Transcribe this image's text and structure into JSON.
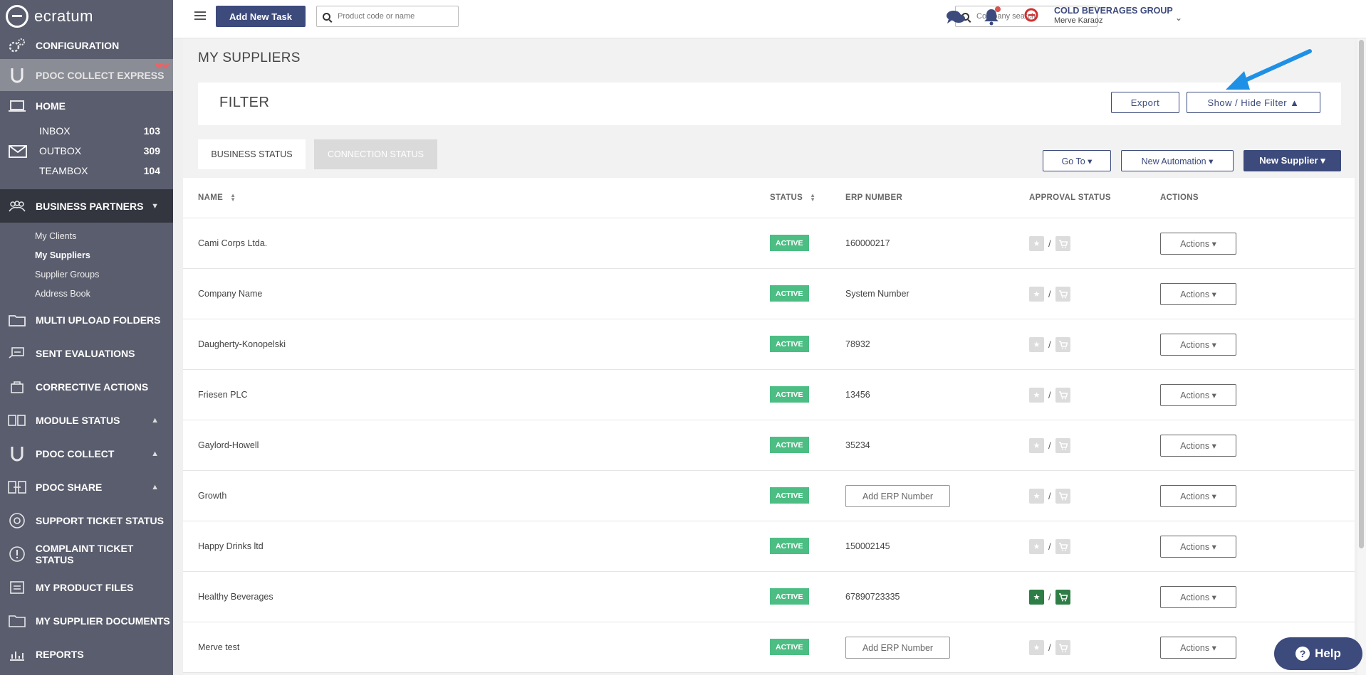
{
  "app": {
    "logo_text": "ecratum"
  },
  "sidebar": {
    "configuration": "CONFIGURATION",
    "pdoc_collect_express": "PDOC COLLECT EXPRESS",
    "new_badge": "NEW!",
    "home": "HOME",
    "inbox": {
      "label": "INBOX",
      "count": "103"
    },
    "outbox": {
      "label": "OUTBOX",
      "count": "309"
    },
    "teambox": {
      "label": "TEAMBOX",
      "count": "104"
    },
    "business_partners": "BUSINESS PARTNERS",
    "sub": [
      "My Clients",
      "My Suppliers",
      "Supplier Groups",
      "Address Book"
    ],
    "multi_upload": "MULTI UPLOAD FOLDERS",
    "sent_evaluations": "SENT EVALUATIONS",
    "corrective_actions": "CORRECTIVE ACTIONS",
    "module_status": "MODULE STATUS",
    "pdoc_collect": "PDOC COLLECT",
    "pdoc_share": "PDOC SHARE",
    "support_ticket": "SUPPORT TICKET STATUS",
    "complaint_ticket": "COMPLAINT TICKET STATUS",
    "product_files": "MY PRODUCT FILES",
    "supplier_documents": "MY SUPPLIER DOCUMENTS",
    "reports": "REPORTS"
  },
  "topbar": {
    "add_task": "Add New Task",
    "product_search_placeholder": "Product code or name",
    "company_search_placeholder": "Company search",
    "company": "COLD BEVERAGES GROUP",
    "user": "Merve Karaoz"
  },
  "page": {
    "title": "MY SUPPLIERS",
    "filter": "FILTER",
    "export": "Export",
    "show_hide": "Show / Hide Filter ▲",
    "tabs": [
      "BUSINESS STATUS",
      "CONNECTION STATUS"
    ],
    "goto": "Go To ▾",
    "new_automation": "New Automation ▾",
    "new_supplier": "New Supplier ▾"
  },
  "table": {
    "headers": {
      "name": "NAME",
      "status": "STATUS",
      "erp": "ERP NUMBER",
      "approval": "APPROVAL STATUS",
      "actions": "ACTIONS"
    },
    "rows": [
      {
        "name": "Cami Corps Ltda.",
        "status": "ACTIVE",
        "erp": "160000217",
        "approved": false
      },
      {
        "name": "Company Name",
        "status": "ACTIVE",
        "erp": "System Number",
        "approved": false
      },
      {
        "name": "Daugherty-Konopelski",
        "status": "ACTIVE",
        "erp": "78932",
        "approved": false
      },
      {
        "name": "Friesen PLC",
        "status": "ACTIVE",
        "erp": "13456",
        "approved": false
      },
      {
        "name": "Gaylord-Howell",
        "status": "ACTIVE",
        "erp": "35234",
        "approved": false
      },
      {
        "name": "Growth",
        "status": "ACTIVE",
        "erp_button": "Add ERP Number",
        "approved": false
      },
      {
        "name": "Happy Drinks ltd",
        "status": "ACTIVE",
        "erp": "150002145",
        "approved": false
      },
      {
        "name": "Healthy Beverages",
        "status": "ACTIVE",
        "erp": "67890723335",
        "approved": true
      },
      {
        "name": "Merve test",
        "status": "ACTIVE",
        "erp_button": "Add ERP Number",
        "approved": false
      }
    ],
    "actions_label": "Actions ▾"
  },
  "help": "Help",
  "colors": {
    "brand": "#3c4a7c",
    "active": "#4cbe84",
    "sidebar": "#5a5d6d",
    "arrow": "#1e90e6"
  }
}
